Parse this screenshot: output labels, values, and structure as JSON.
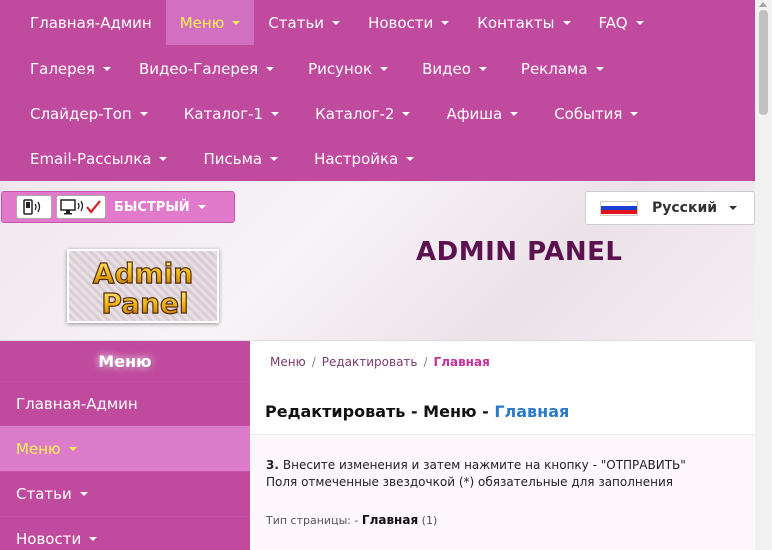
{
  "topnav": {
    "rows": [
      [
        {
          "label": "Главная-Админ",
          "caret": false,
          "active": false
        },
        {
          "label": "Меню",
          "caret": true,
          "active": true
        },
        {
          "label": "Статьи",
          "caret": true,
          "active": false
        },
        {
          "label": "Новости",
          "caret": true,
          "active": false
        },
        {
          "label": "Контакты",
          "caret": true,
          "active": false
        },
        {
          "label": "FAQ",
          "caret": true,
          "active": false
        }
      ],
      [
        {
          "label": "Галерея",
          "caret": true,
          "active": false
        },
        {
          "label": "Видео-Галерея",
          "caret": true,
          "active": false
        },
        {
          "label": "Рисунок",
          "caret": true,
          "active": false
        },
        {
          "label": "Видео",
          "caret": true,
          "active": false
        },
        {
          "label": "Реклама",
          "caret": true,
          "active": false
        }
      ],
      [
        {
          "label": "Слайдер-Топ",
          "caret": true,
          "active": false
        },
        {
          "label": "Каталог-1",
          "caret": true,
          "active": false
        },
        {
          "label": "Каталог-2",
          "caret": true,
          "active": false
        },
        {
          "label": "Афиша",
          "caret": true,
          "active": false
        },
        {
          "label": "События",
          "caret": true,
          "active": false
        }
      ],
      [
        {
          "label": "Email-Рассылка",
          "caret": true,
          "active": false
        },
        {
          "label": "Письма",
          "caret": true,
          "active": false
        },
        {
          "label": "Настройка",
          "caret": true,
          "active": false
        }
      ]
    ]
  },
  "header": {
    "speed_label": "БЫСТРЫЙ",
    "language_label": "Русский",
    "admin_title": "ADMIN PANEL",
    "logo_line1": "Admin",
    "logo_line2": "Panel"
  },
  "sidebar": {
    "title": "Меню",
    "items": [
      {
        "label": "Главная-Админ",
        "caret": false,
        "active": false
      },
      {
        "label": "Меню",
        "caret": true,
        "active": true
      },
      {
        "label": "Статьи",
        "caret": true,
        "active": false
      },
      {
        "label": "Новости",
        "caret": true,
        "active": false
      }
    ]
  },
  "main": {
    "breadcrumb": [
      "Меню",
      "Редактировать",
      "Главная"
    ],
    "title_prefix": "Редактировать - Меню - ",
    "title_accent": "Главная",
    "step_number": "3.",
    "instruction_line1": "Внесите изменения и затем нажмите на кнопку - \"ОТПРАВИТЬ\"",
    "instruction_line2": "Поля отмеченные звездочкой (*) обязательные для заполнения",
    "page_type_label": "Тип страницы: - ",
    "page_type_value": "Главная",
    "page_type_id": "(1)"
  },
  "colors": {
    "nav_bg": "#c04a9e",
    "nav_active_bg": "#d26fc0",
    "active_text": "#fff34f",
    "title_color": "#5c1250",
    "accent_blue": "#2a7ac8",
    "breadcrumb_current": "#c4309c"
  }
}
